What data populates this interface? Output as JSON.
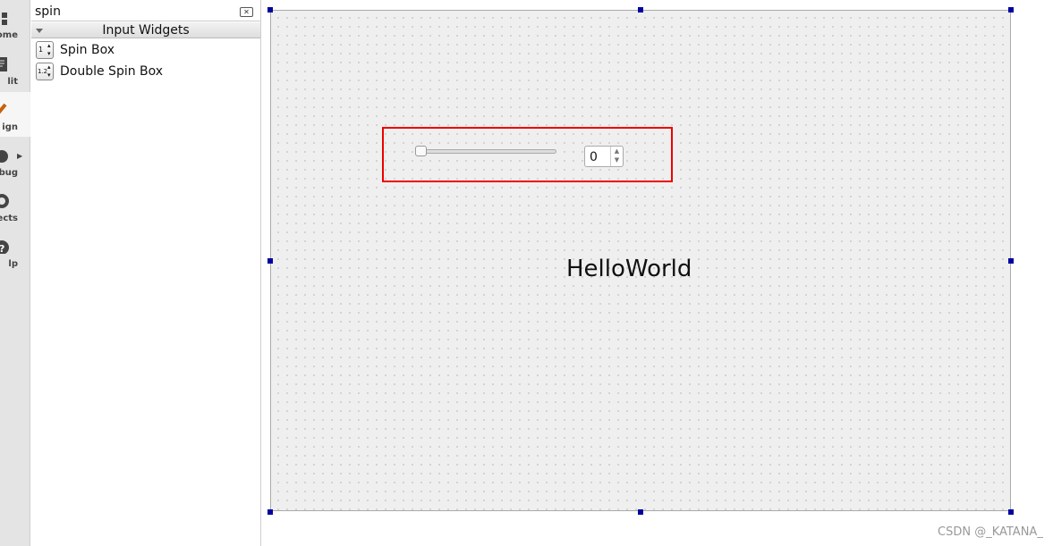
{
  "modebar": {
    "items": [
      {
        "label": "ome",
        "icon": "grid-icon"
      },
      {
        "label": "lit",
        "icon": "document-icon"
      },
      {
        "label": "ign",
        "icon": "pencil-icon",
        "selected": true
      },
      {
        "label": "bug",
        "icon": "bug-icon"
      },
      {
        "label": "ects",
        "icon": "wrench-icon"
      },
      {
        "label": "lp",
        "icon": "help-icon"
      }
    ]
  },
  "widget_box": {
    "search_value": "spin",
    "category": "Input Widgets",
    "items": [
      {
        "label": "Spin Box",
        "icon_text": "1"
      },
      {
        "label": "Double Spin Box",
        "icon_text": "1.2"
      }
    ]
  },
  "form": {
    "slider_value": 0,
    "spinbox_value": "0",
    "label_text": "HelloWorld",
    "highlight_color": "#e00000",
    "handle_color": "#0000a0"
  },
  "watermark": "CSDN @_KATANA_"
}
